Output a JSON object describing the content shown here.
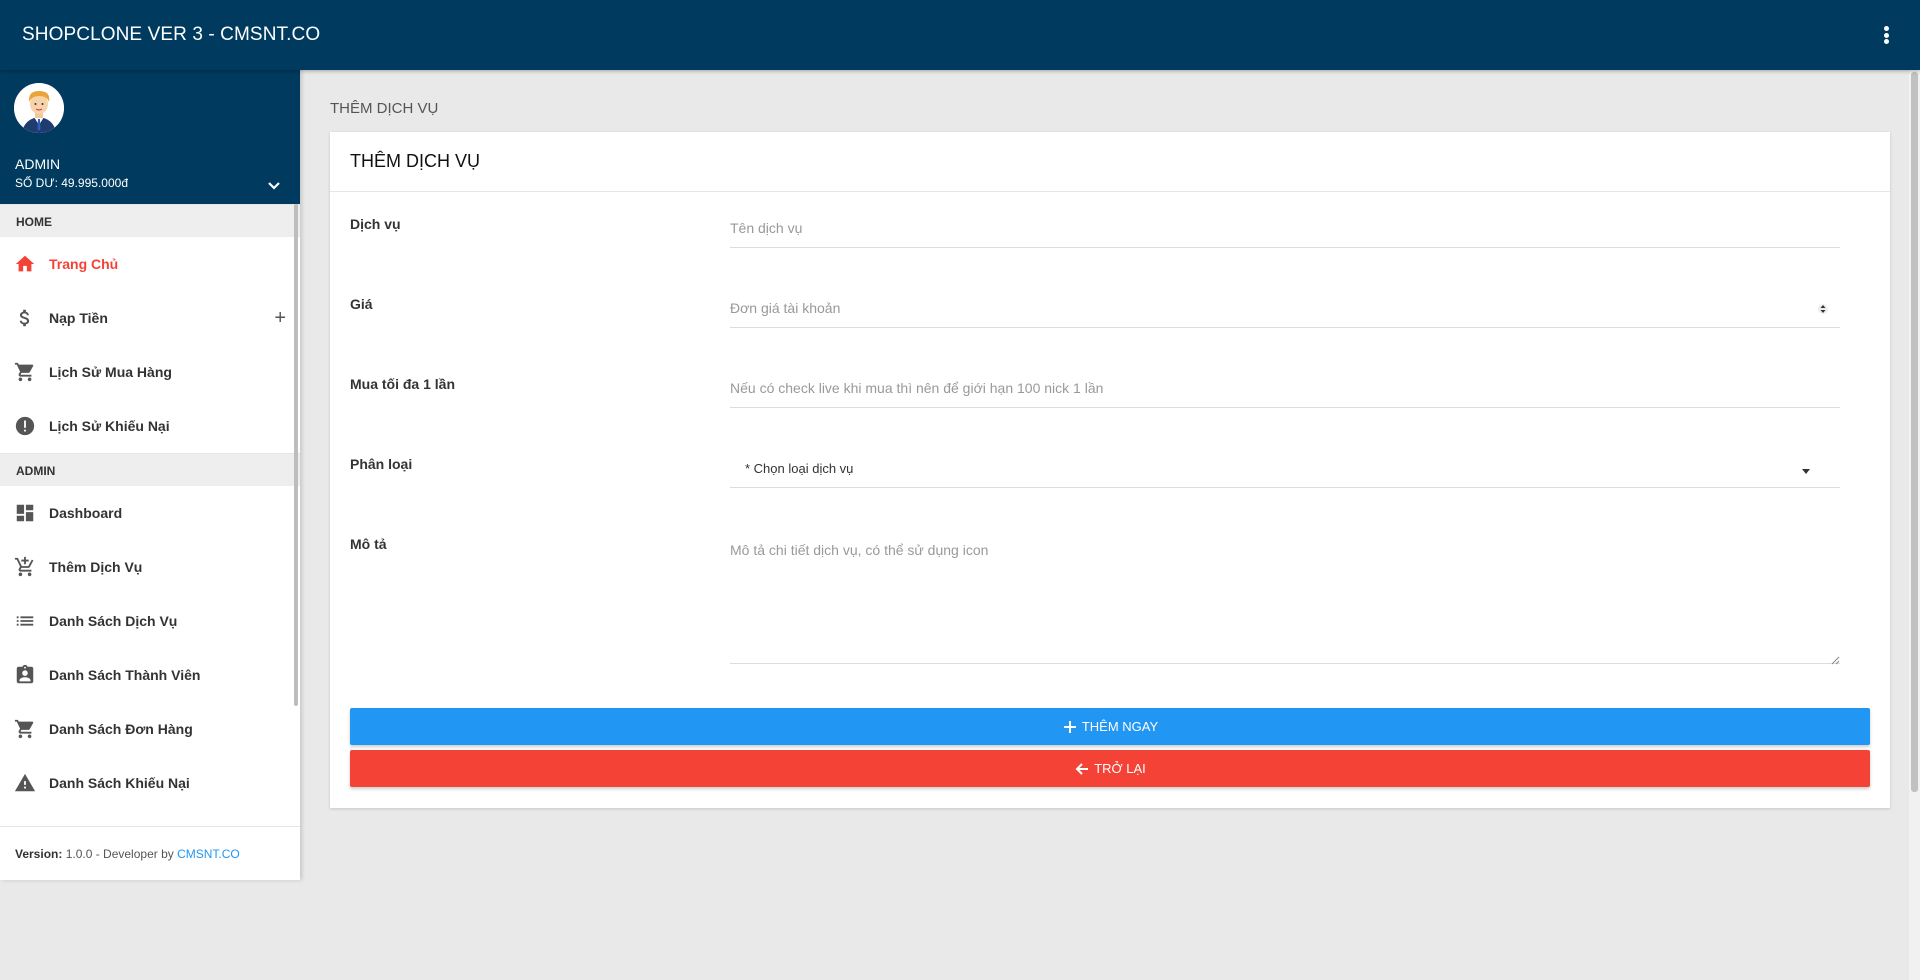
{
  "app": {
    "title": "SHOPCLONE VER 3 - CMSNT.CO"
  },
  "user": {
    "name": "ADMIN",
    "balance": "SỐ DƯ: 49.995.000đ"
  },
  "sidebar": {
    "sections": [
      {
        "header": "HOME",
        "items": [
          {
            "label": "Trang Chủ",
            "icon": "home-icon"
          },
          {
            "label": "Nạp Tiền",
            "icon": "dollar-icon",
            "expandable": true
          },
          {
            "label": "Lịch Sử Mua Hàng",
            "icon": "cart-icon"
          },
          {
            "label": "Lịch Sử Khiếu Nại",
            "icon": "alert-circle-icon"
          }
        ]
      },
      {
        "header": "ADMIN",
        "items": [
          {
            "label": "Dashboard",
            "icon": "dashboard-icon"
          },
          {
            "label": "Thêm Dịch Vụ",
            "icon": "add-cart-icon"
          },
          {
            "label": "Danh Sách Dịch Vụ",
            "icon": "list-icon"
          },
          {
            "label": "Danh Sách Thành Viên",
            "icon": "member-badge-icon"
          },
          {
            "label": "Danh Sách Đơn Hàng",
            "icon": "cart-icon"
          },
          {
            "label": "Danh Sách Khiếu Nại",
            "icon": "warning-icon"
          }
        ]
      }
    ],
    "active": "Trang Chủ",
    "footer": {
      "version_label": "Version:",
      "version_text": " 1.0.0 - Developer by ",
      "link": "CMSNT.CO"
    }
  },
  "page": {
    "title": "THÊM DỊCH VỤ"
  },
  "card": {
    "title": "THÊM DỊCH VỤ",
    "fields": {
      "service": {
        "label": "Dịch vụ",
        "placeholder": "Tên dịch vụ",
        "value": ""
      },
      "price": {
        "label": "Giá",
        "placeholder": "Đơn giá tài khoản",
        "value": ""
      },
      "max_buy": {
        "label": "Mua tối đa 1 lần",
        "placeholder": "Nếu có check live khi mua thì nên để giới hạn 100 nick 1 lần",
        "value": ""
      },
      "category": {
        "label": "Phân loại",
        "selected": "* Chọn loại dịch vụ"
      },
      "description": {
        "label": "Mô tả",
        "placeholder": "Mô tả chi tiết dịch vụ, có thể sử dụng icon",
        "value": ""
      }
    },
    "buttons": {
      "submit": "THÊM NGAY",
      "back": "TRỞ LẠI"
    }
  },
  "colors": {
    "topbar": "#003b5f",
    "primary": "#2196f3",
    "danger": "#f44336",
    "active_menu": "#f44336"
  }
}
